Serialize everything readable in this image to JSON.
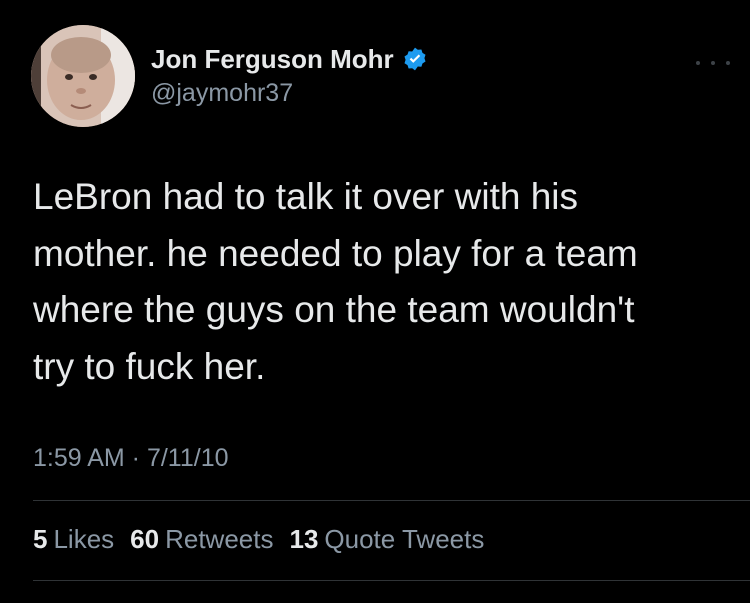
{
  "tweet": {
    "author": {
      "display_name": "Jon Ferguson Mohr",
      "handle": "@jaymohr37",
      "verified": true,
      "verified_color": "#1d9bf0"
    },
    "text": "LeBron had to talk it over with his\nmother. he needed to play for a team\nwhere the guys on the team wouldn't\ntry to fuck her.",
    "timestamp": "1:59 AM · 7/11/10",
    "stats": {
      "likes": {
        "count": "5",
        "label": "Likes"
      },
      "retweets": {
        "count": "60",
        "label": "Retweets"
      },
      "quote_tweets": {
        "count": "13",
        "label": "Quote Tweets"
      }
    },
    "icons": {
      "more": "more-options-icon",
      "verified": "verified-badge-icon"
    }
  },
  "colors": {
    "background": "#000000",
    "primary_text": "#e7e9ea",
    "secondary_text": "#8b98a5",
    "divider": "#2f3336",
    "accent": "#1d9bf0"
  }
}
